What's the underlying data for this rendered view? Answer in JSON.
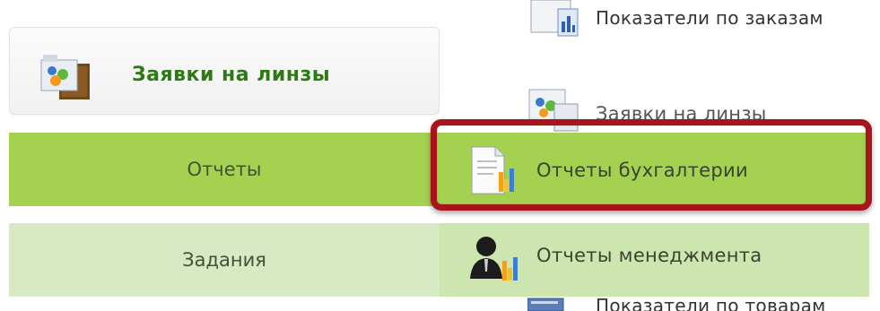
{
  "lens_orders": {
    "label": "Заявки на линзы",
    "icon": "lens-orders-icon"
  },
  "nav": {
    "reports_label": "Отчеты",
    "tasks_label": "Задания"
  },
  "submenu": {
    "order_metrics": "Показатели по заказам",
    "lens_orders_partial": "Заявки на линзы",
    "accounting_reports": "Отчеты бухгалтерии",
    "management_reports": "Отчеты менеджмента",
    "product_metrics": "Показатели по товарам"
  },
  "colors": {
    "active_green": "#a4d14f",
    "light_green": "#d7eac3",
    "highlight_red": "#a8141b",
    "lens_label_green": "#2c7a14"
  }
}
